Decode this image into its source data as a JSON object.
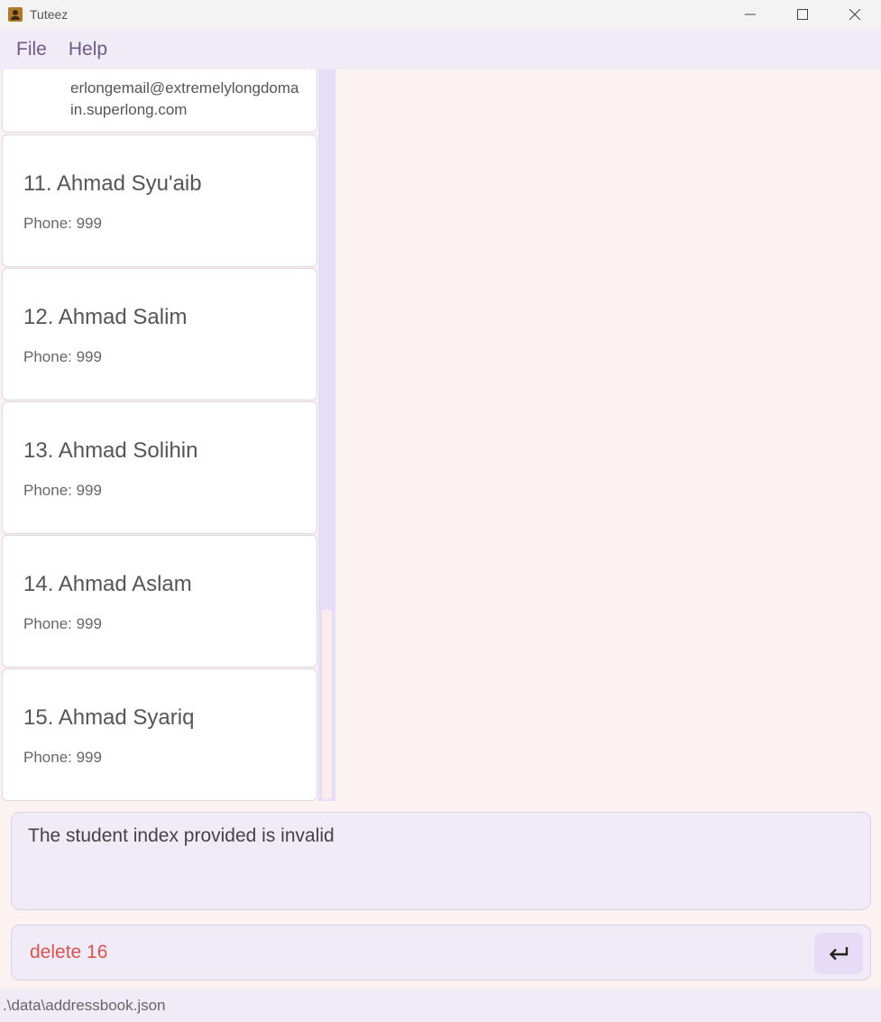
{
  "window": {
    "title": "Tuteez"
  },
  "menu": {
    "file": "File",
    "help": "Help"
  },
  "partial_card": {
    "email_lines": [
      "erlongemail@extremelylongdoma",
      "in.superlong.com"
    ]
  },
  "students": [
    {
      "name": "11. Ahmad Syu'aib",
      "phone": "Phone: 999"
    },
    {
      "name": "12. Ahmad Salim",
      "phone": "Phone: 999"
    },
    {
      "name": "13. Ahmad Solihin",
      "phone": "Phone: 999"
    },
    {
      "name": "14. Ahmad Aslam",
      "phone": "Phone: 999"
    },
    {
      "name": "15. Ahmad Syariq",
      "phone": "Phone: 999"
    }
  ],
  "result": {
    "message": "The student index provided is invalid"
  },
  "command": {
    "value": "delete 16"
  },
  "status": {
    "path": ".\\data\\addressbook.json"
  },
  "colors": {
    "accent": "#e6dcf6",
    "error_text": "#d9534f",
    "menu_bg": "#f1ebf8",
    "app_bg": "#fdf2f2"
  }
}
